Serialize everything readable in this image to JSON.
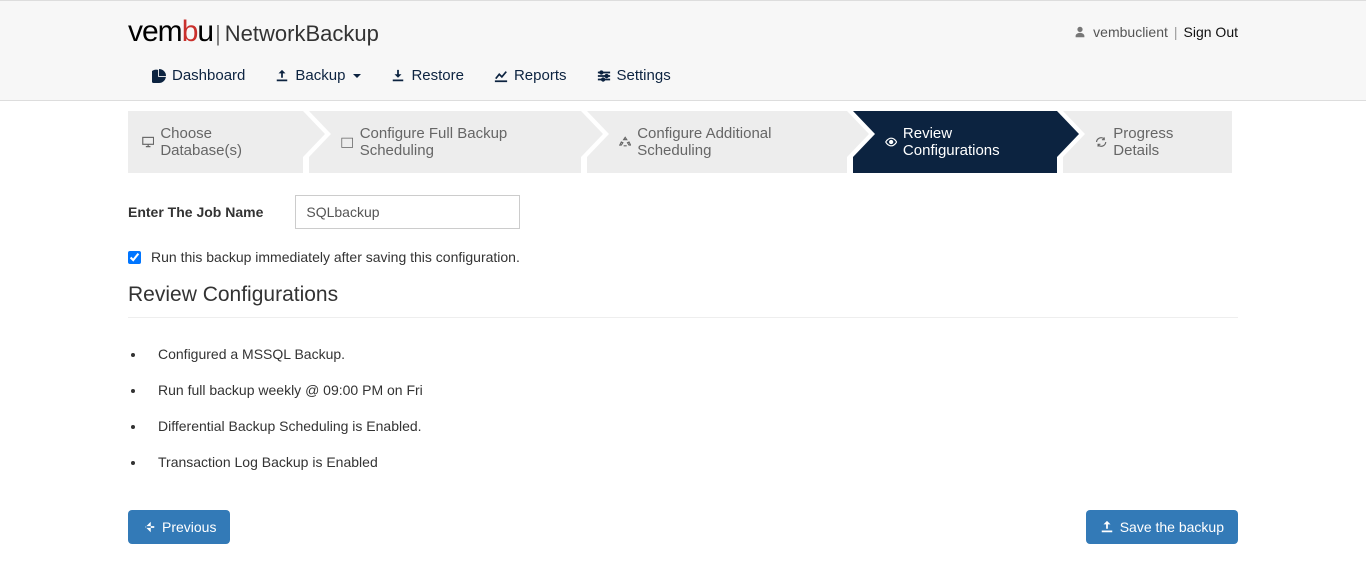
{
  "header": {
    "brand_prefix": "vem",
    "brand_red": "b",
    "brand_suffix": "u",
    "product": "NetworkBackup",
    "username": "vembuclient",
    "signout": "Sign Out"
  },
  "nav": {
    "dashboard": "Dashboard",
    "backup": "Backup",
    "restore": "Restore",
    "reports": "Reports",
    "settings": "Settings"
  },
  "wizard": {
    "step1": "Choose Database(s)",
    "step2": "Configure Full Backup Scheduling",
    "step3": "Configure Additional Scheduling",
    "step4": "Review Configurations",
    "step5": "Progress Details"
  },
  "form": {
    "job_name_label": "Enter The Job Name",
    "job_name_value": "SQLbackup",
    "run_immediate_label": "Run this backup immediately after saving this configuration.",
    "run_immediate_checked": true
  },
  "review": {
    "title": "Review Configurations",
    "items": [
      "Configured a MSSQL Backup.",
      "Run full backup weekly @ 09:00 PM on Fri",
      "Differential Backup Scheduling is Enabled.",
      "Transaction Log Backup is Enabled"
    ]
  },
  "buttons": {
    "previous": "Previous",
    "save": "Save the backup"
  }
}
